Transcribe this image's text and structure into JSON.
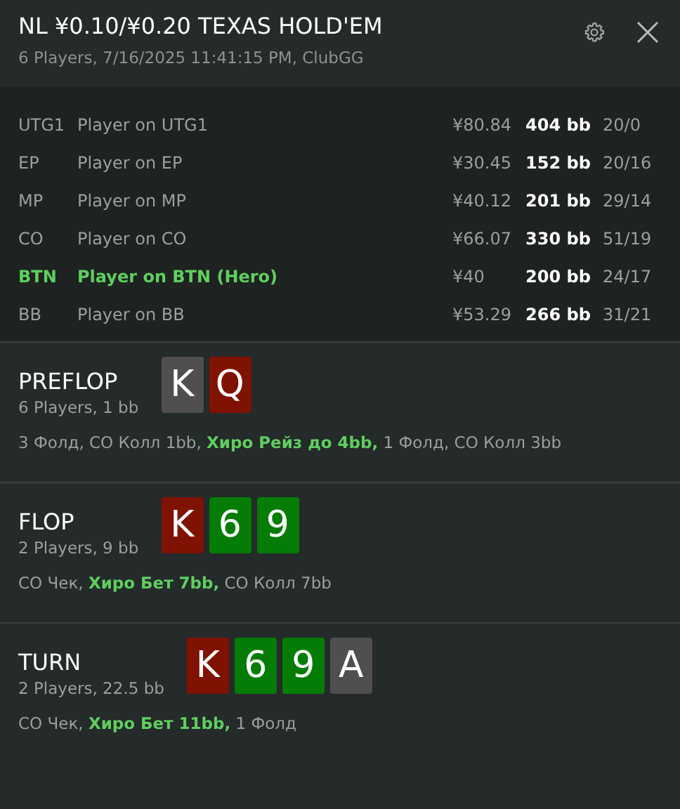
{
  "header": {
    "title": "NL ¥0.10/¥0.20 TEXAS HOLD'EM",
    "subtitle": "6 Players, 7/16/2025 11:41:15 PM, ClubGG"
  },
  "players": [
    {
      "position": "UTG1",
      "name": "Player on UTG1",
      "stack": "¥80.84",
      "bb": "404 bb",
      "stats": "20/0",
      "hero": false
    },
    {
      "position": "EP",
      "name": "Player on EP",
      "stack": "¥30.45",
      "bb": "152 bb",
      "stats": "20/16",
      "hero": false
    },
    {
      "position": "MP",
      "name": "Player on MP",
      "stack": "¥40.12",
      "bb": "201 bb",
      "stats": "29/14",
      "hero": false
    },
    {
      "position": "CO",
      "name": "Player on CO",
      "stack": "¥66.07",
      "bb": "330 bb",
      "stats": "51/19",
      "hero": false
    },
    {
      "position": "BTN",
      "name": "Player on BTN (Hero)",
      "stack": "¥40",
      "bb": "200 bb",
      "stats": "24/17",
      "hero": true
    },
    {
      "position": "BB",
      "name": "Player on BB",
      "stack": "¥53.29",
      "bb": "266 bb",
      "stats": "31/21",
      "hero": false
    }
  ],
  "streets": [
    {
      "name": "PREFLOP",
      "info": "6 Players, 1 bb",
      "cards": [
        {
          "rank": "K",
          "color": "#4f4f4f"
        },
        {
          "rank": "Q",
          "color": "#7f1200"
        }
      ],
      "actions": "3 Фолд, CO Колл 1bb, **Хиро Рейз до 4bb,** 1 Фолд, CO Колл 3bb"
    },
    {
      "name": "FLOP",
      "info": "2 Players, 9 bb",
      "cards": [
        {
          "rank": "K",
          "color": "#7f1200"
        },
        {
          "rank": "6",
          "color": "#057c05"
        },
        {
          "rank": "9",
          "color": "#057c05"
        }
      ],
      "actions": "CO Чек, **Хиро Бет 7bb,** CO Колл 7bb"
    },
    {
      "name": "TURN",
      "info": "2 Players, 22.5 bb",
      "cards": [
        {
          "rank": "K",
          "color": "#7f1200"
        },
        {
          "rank": "6",
          "color": "#057c05"
        },
        {
          "rank": "9",
          "color": "#057c05"
        },
        {
          "rank": "A",
          "color": "#4f4f4f"
        }
      ],
      "actions": "CO Чек, **Хиро Бет 11bb,** 1 Фолд"
    }
  ]
}
